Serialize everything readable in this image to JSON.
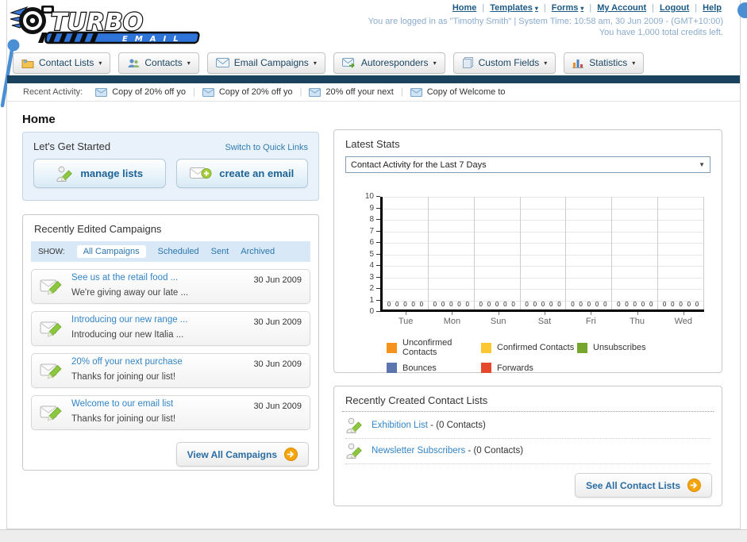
{
  "header": {
    "nav": [
      {
        "label": "Home",
        "dropdown": false
      },
      {
        "label": "Templates",
        "dropdown": true
      },
      {
        "label": "Forms",
        "dropdown": true
      },
      {
        "label": "My Account",
        "dropdown": false
      },
      {
        "label": "Logout",
        "dropdown": false
      },
      {
        "label": "Help",
        "dropdown": false
      }
    ],
    "login_info": "You are logged in as \"Timothy Smith\" | System Time: 10:58 am, 30 Jun 2009 - (GMT+10:00)",
    "credits_info": "You have 1,000 total credits left.",
    "logo_title": "TURBO",
    "logo_subtitle": "EMAIL"
  },
  "tabs": [
    {
      "label": "Contact Lists",
      "icon": "folder-icon"
    },
    {
      "label": "Contacts",
      "icon": "contacts-icon"
    },
    {
      "label": "Email Campaigns",
      "icon": "envelope-icon"
    },
    {
      "label": "Autoresponders",
      "icon": "autoresponder-icon"
    },
    {
      "label": "Custom Fields",
      "icon": "pages-icon"
    },
    {
      "label": "Statistics",
      "icon": "chart-icon"
    }
  ],
  "recent_activity": {
    "label": "Recent Activity:",
    "items": [
      "Copy of 20% off yo",
      "Copy of 20% off yo",
      "20% off your next",
      "Copy of Welcome to"
    ]
  },
  "page_title": "Home",
  "get_started": {
    "title": "Let's Get Started",
    "switch_link": "Switch to Quick Links",
    "buttons": [
      {
        "label": "manage lists"
      },
      {
        "label": "create an email"
      }
    ]
  },
  "campaigns": {
    "title": "Recently Edited Campaigns",
    "show_label": "SHOW:",
    "filters": [
      "All Campaigns",
      "Scheduled",
      "Sent",
      "Archived"
    ],
    "active_filter": "All Campaigns",
    "items": [
      {
        "title": "See us at the retail food ...",
        "subtitle": "We're giving away our late ...",
        "date": "30 Jun 2009"
      },
      {
        "title": "Introducing our new range ...",
        "subtitle": "Introducing our new Italia ...",
        "date": "30 Jun 2009"
      },
      {
        "title": "20% off your next purchase",
        "subtitle": "Thanks for joining our list!",
        "date": "30 Jun 2009"
      },
      {
        "title": "Welcome to our email list",
        "subtitle": "Thanks for joining our list!",
        "date": "30 Jun 2009"
      }
    ],
    "view_all_label": "View All Campaigns"
  },
  "stats": {
    "title": "Latest Stats",
    "dropdown_value": "Contact Activity for the Last 7 Days"
  },
  "chart_data": {
    "type": "bar",
    "title": "Contact Activity for the Last 7 Days",
    "categories": [
      "Tue",
      "Mon",
      "Sun",
      "Sat",
      "Fri",
      "Thu",
      "Wed"
    ],
    "series": [
      {
        "name": "Unconfirmed Contacts",
        "color": "#F6921E",
        "values": [
          0,
          0,
          0,
          0,
          0,
          0,
          0
        ]
      },
      {
        "name": "Confirmed Contacts",
        "color": "#FBC831",
        "values": [
          0,
          0,
          0,
          0,
          0,
          0,
          0
        ]
      },
      {
        "name": "Unsubscribes",
        "color": "#76A72C",
        "values": [
          0,
          0,
          0,
          0,
          0,
          0,
          0
        ]
      },
      {
        "name": "Bounces",
        "color": "#5C75AE",
        "values": [
          0,
          0,
          0,
          0,
          0,
          0,
          0
        ]
      },
      {
        "name": "Forwards",
        "color": "#E5492D",
        "values": [
          0,
          0,
          0,
          0,
          0,
          0,
          0
        ]
      }
    ],
    "xlabel": "",
    "ylabel": "",
    "ylim": [
      0,
      10
    ],
    "ytick_step": 1,
    "grid": true,
    "legend_position": "bottom"
  },
  "contact_lists": {
    "title": "Recently Created Contact Lists",
    "items": [
      {
        "name": "Exhibition List",
        "suffix": " - (0 Contacts)"
      },
      {
        "name": "Newsletter Subscribers",
        "suffix": " - (0 Contacts)"
      }
    ],
    "see_all_label": "See All Contact Lists"
  },
  "colors": {
    "accent_blue": "#2f7cb4",
    "navy_bar": "#1a425f",
    "annotation_blue": "#4a8fd3",
    "button_text": "#2b6da3",
    "arrow_orange": "#f5a409"
  }
}
